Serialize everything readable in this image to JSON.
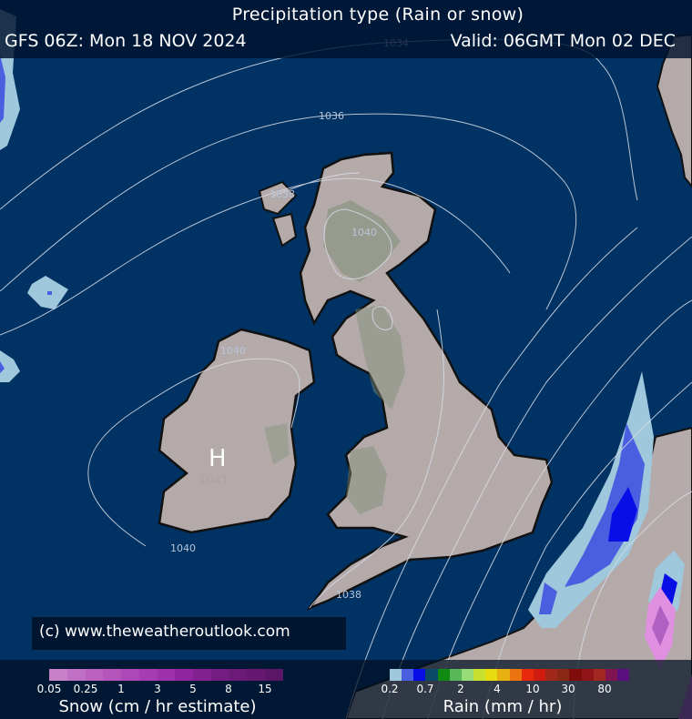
{
  "header": {
    "title": "Precipitation type (Rain or snow)",
    "run": "GFS 06Z: Mon 18 NOV 2024",
    "valid": "Valid: 06GMT Mon 02 DEC"
  },
  "copyright": "(c) www.theweatheroutlook.com",
  "isobar_labels": [
    "1034",
    "1036",
    "1038",
    "1040",
    "1040",
    "1041",
    "1040",
    "1038"
  ],
  "pressure_centre": {
    "symbol": "H",
    "value": "1041"
  },
  "legend": {
    "snow": {
      "title": "Snow (cm / hr estimate)",
      "ticks": [
        "0.05",
        "0.25",
        "1",
        "3",
        "5",
        "8",
        "15"
      ],
      "colors": [
        "#c880c8",
        "#c070c4",
        "#bb62c0",
        "#b555bc",
        "#ae48b8",
        "#a63cb2",
        "#9e30ac",
        "#8f26a0",
        "#822090",
        "#751c82",
        "#6c1a78",
        "#641870",
        "#5c1668"
      ]
    },
    "rain": {
      "title": "Rain (mm / hr)",
      "ticks": [
        "0.2",
        "0.7",
        "2",
        "4",
        "10",
        "30",
        "80"
      ],
      "colors": [
        "#a0c8dc",
        "#4a5ee0",
        "#0a0ee6",
        "#0a4a68",
        "#108a10",
        "#58b858",
        "#98dc78",
        "#c8e030",
        "#e8dc10",
        "#e8b010",
        "#ec7410",
        "#e8280c",
        "#d01c10",
        "#a02818",
        "#882814",
        "#800c0c",
        "#901418",
        "#a02820",
        "#801450",
        "#5c1080"
      ]
    }
  },
  "colors": {
    "sea": "#003264",
    "land": "#b4aaaa",
    "highland": "#7e8e76",
    "isobar": "#d8dde8"
  }
}
